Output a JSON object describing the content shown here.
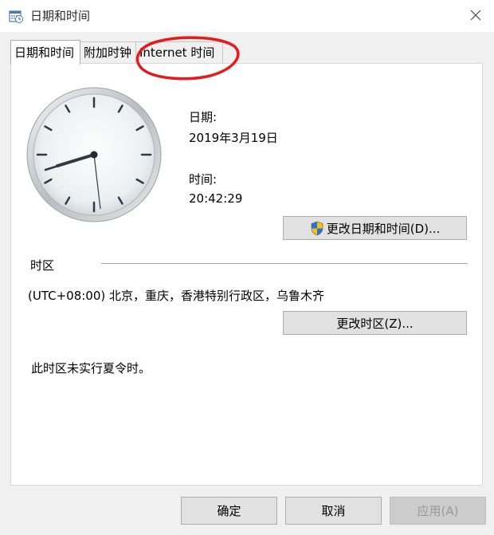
{
  "window": {
    "title": "日期和时间"
  },
  "tabs": [
    {
      "label": "日期和时间",
      "active": true
    },
    {
      "label": "附加时钟",
      "active": false
    },
    {
      "label": "Internet 时间",
      "active": false
    }
  ],
  "datetime": {
    "date_label": "日期:",
    "date_value": "2019年3月19日",
    "time_label": "时间:",
    "time_value": "20:42:29",
    "change_button": "更改日期和时间(D)..."
  },
  "timezone": {
    "section_label": "时区",
    "value": "(UTC+08:00) 北京，重庆，香港特别行政区，乌鲁木齐",
    "change_button": "更改时区(Z)...",
    "dst_note": "此时区未实行夏令时。"
  },
  "footer": {
    "ok": "确定",
    "cancel": "取消",
    "apply": "应用(A)"
  },
  "annotation_color": "#e8191c"
}
